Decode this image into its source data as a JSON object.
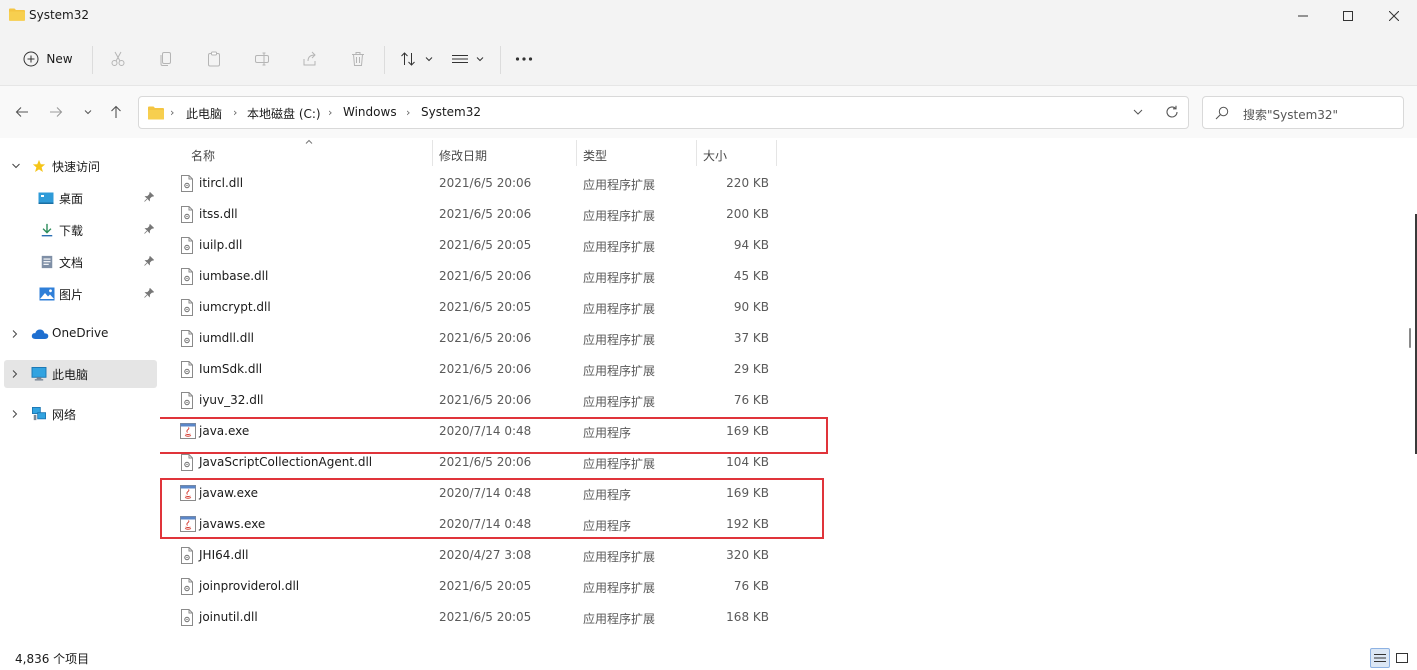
{
  "window": {
    "title": "System32",
    "min_icon": "minimize-icon",
    "max_icon": "maximize-icon",
    "close_icon": "close-icon"
  },
  "toolbar": {
    "new_label": "New",
    "icons": [
      "plus-circle-icon",
      "cut-icon",
      "copy-icon",
      "paste-icon",
      "rename-icon",
      "share-icon",
      "delete-icon",
      "sort-icon",
      "view-icon",
      "more-icon"
    ]
  },
  "address": {
    "crumbs": [
      "此电脑",
      "本地磁盘 (C:)",
      "Windows",
      "System32"
    ]
  },
  "search": {
    "placeholder": "搜索\"System32\""
  },
  "sidebar": {
    "items": [
      {
        "label": "快速访问",
        "icon": "star-icon"
      },
      {
        "label": "桌面",
        "icon": "desktop-icon"
      },
      {
        "label": "下载",
        "icon": "download-icon"
      },
      {
        "label": "文档",
        "icon": "document-icon"
      },
      {
        "label": "图片",
        "icon": "picture-icon"
      },
      {
        "label": "OneDrive",
        "icon": "cloud-icon"
      },
      {
        "label": "此电脑",
        "icon": "computer-icon"
      },
      {
        "label": "网络",
        "icon": "network-icon"
      }
    ]
  },
  "columns": {
    "name": "名称",
    "date": "修改日期",
    "type": "类型",
    "size": "大小"
  },
  "files": [
    {
      "name": "itircl.dll",
      "date": "2021/6/5 20:06",
      "type": "应用程序扩展",
      "size": "220 KB",
      "icon": "dll-file-icon"
    },
    {
      "name": "itss.dll",
      "date": "2021/6/5 20:06",
      "type": "应用程序扩展",
      "size": "200 KB",
      "icon": "dll-file-icon"
    },
    {
      "name": "iuilp.dll",
      "date": "2021/6/5 20:05",
      "type": "应用程序扩展",
      "size": "94 KB",
      "icon": "dll-file-icon"
    },
    {
      "name": "iumbase.dll",
      "date": "2021/6/5 20:06",
      "type": "应用程序扩展",
      "size": "45 KB",
      "icon": "dll-file-icon"
    },
    {
      "name": "iumcrypt.dll",
      "date": "2021/6/5 20:05",
      "type": "应用程序扩展",
      "size": "90 KB",
      "icon": "dll-file-icon"
    },
    {
      "name": "iumdll.dll",
      "date": "2021/6/5 20:06",
      "type": "应用程序扩展",
      "size": "37 KB",
      "icon": "dll-file-icon"
    },
    {
      "name": "IumSdk.dll",
      "date": "2021/6/5 20:06",
      "type": "应用程序扩展",
      "size": "29 KB",
      "icon": "dll-file-icon"
    },
    {
      "name": "iyuv_32.dll",
      "date": "2021/6/5 20:06",
      "type": "应用程序扩展",
      "size": "76 KB",
      "icon": "dll-file-icon"
    },
    {
      "name": "java.exe",
      "date": "2020/7/14 0:48",
      "type": "应用程序",
      "size": "169 KB",
      "icon": "java-exe-icon"
    },
    {
      "name": "JavaScriptCollectionAgent.dll",
      "date": "2021/6/5 20:06",
      "type": "应用程序扩展",
      "size": "104 KB",
      "icon": "dll-file-icon"
    },
    {
      "name": "javaw.exe",
      "date": "2020/7/14 0:48",
      "type": "应用程序",
      "size": "169 KB",
      "icon": "java-exe-icon"
    },
    {
      "name": "javaws.exe",
      "date": "2020/7/14 0:48",
      "type": "应用程序",
      "size": "192 KB",
      "icon": "java-exe-icon"
    },
    {
      "name": "JHI64.dll",
      "date": "2020/4/27 3:08",
      "type": "应用程序扩展",
      "size": "320 KB",
      "icon": "dll-file-icon"
    },
    {
      "name": "joinproviderol.dll",
      "date": "2021/6/5 20:05",
      "type": "应用程序扩展",
      "size": "76 KB",
      "icon": "dll-file-icon"
    },
    {
      "name": "joinutil.dll",
      "date": "2021/6/5 20:05",
      "type": "应用程序扩展",
      "size": "168 KB",
      "icon": "dll-file-icon"
    }
  ],
  "status": {
    "count": "4,836 个项目"
  },
  "colors": {
    "highlight": "#e0343a",
    "folder": "#f4c542",
    "selected_bg": "#e5e5e5"
  }
}
